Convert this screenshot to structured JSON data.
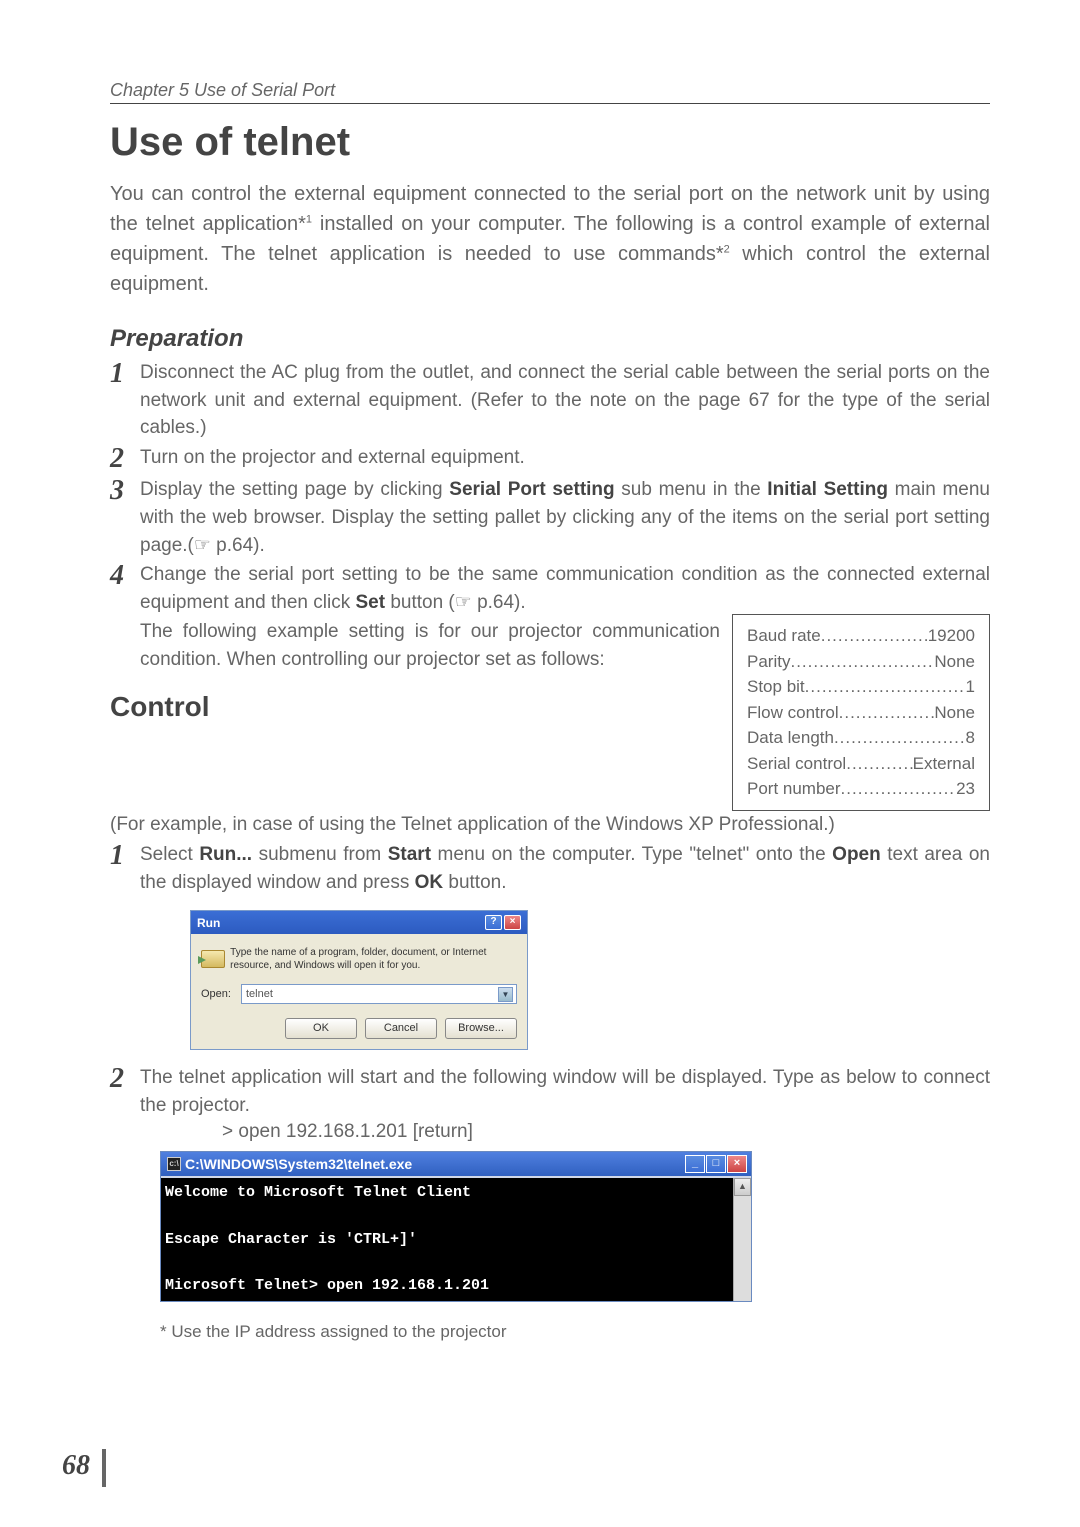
{
  "page_number": "68",
  "chapter_header": "Chapter 5 Use of Serial Port",
  "main_title": "Use of telnet",
  "intro_text_1": "You can control the external equipment connected to the serial port on the network unit by using the telnet application*",
  "intro_sup_1": "1",
  "intro_text_2": " installed on your computer. The following is a control example of external equipment. The telnet application is needed to use commands*",
  "intro_sup_2": "2",
  "intro_text_3": " which control the external equipment.",
  "preparation": {
    "title": "Preparation",
    "step1": "Disconnect the AC plug from the outlet, and connect the serial cable between the serial ports on the network unit and external equipment. (Refer to the note on the page 67 for the type of the serial cables.)",
    "step2": "Turn on the projector and external equipment.",
    "step3_a": "Display the setting page by clicking ",
    "step3_b": "Serial Port setting",
    "step3_c": " sub menu in the ",
    "step3_d": "Initial Setting",
    "step3_e": " main menu with the web browser. Display the setting pallet by clicking any of the items on the serial port setting page.(☞ p.64).",
    "step4_a": "Change the serial port setting to be the same communication condition as the connected external equipment and then click ",
    "step4_b": "Set",
    "step4_c": " button (☞ p.64).",
    "step4_follow": "The following example setting is for our projector communication condition. When controlling our projector set as follows:"
  },
  "settings": [
    {
      "label": "Baud rate",
      "val": "19200"
    },
    {
      "label": "Parity",
      "val": "None"
    },
    {
      "label": "Stop bit",
      "val": "1"
    },
    {
      "label": "Flow control",
      "val": "None"
    },
    {
      "label": "Data length",
      "val": "8"
    },
    {
      "label": "Serial control",
      "val": "External"
    },
    {
      "label": "Port number",
      "val": "23"
    }
  ],
  "control": {
    "title": "Control",
    "subtitle": "(For example, in case of using the Telnet application of the Windows XP Professional.)",
    "step1_a": "Select ",
    "step1_b": "Run...",
    "step1_c": " submenu from ",
    "step1_d": "Start",
    "step1_e": " menu on the computer. Type \"telnet\" onto the ",
    "step1_f": "Open",
    "step1_g": " text area on the displayed window and press ",
    "step1_h": "OK",
    "step1_i": " button.",
    "step2": "The telnet application will start and the following window will be displayed. Type as below to connect the projector.",
    "command": "> open 192.168.1.201 [return]"
  },
  "run_dialog": {
    "title": "Run",
    "description": "Type the name of a program, folder, document, or Internet resource, and Windows will open it for you.",
    "open_label": "Open:",
    "open_value": "telnet",
    "btn_ok": "OK",
    "btn_cancel": "Cancel",
    "btn_browse": "Browse..."
  },
  "telnet_window": {
    "title": "C:\\WINDOWS\\System32\\telnet.exe",
    "line1": "Welcome to Microsoft Telnet Client",
    "line2": "Escape Character is 'CTRL+]'",
    "line3": "Microsoft Telnet> open 192.168.1.201"
  },
  "footnote": "* Use the IP address assigned to the projector"
}
